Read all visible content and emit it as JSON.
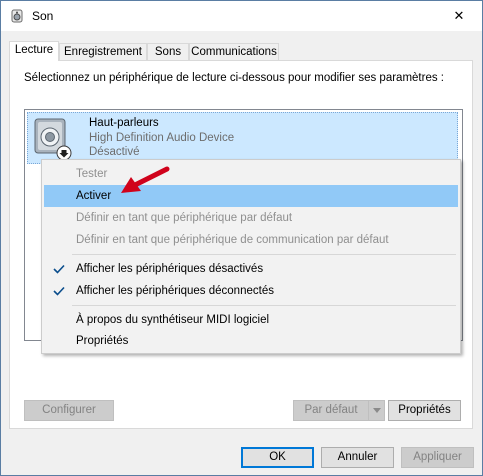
{
  "window": {
    "title": "Son",
    "close_symbol": "✕"
  },
  "tabs": [
    {
      "label": "Lecture",
      "active": true
    },
    {
      "label": "Enregistrement",
      "active": false
    },
    {
      "label": "Sons",
      "active": false
    },
    {
      "label": "Communications",
      "active": false
    }
  ],
  "panel": {
    "instruction": "Sélectionnez un périphérique de lecture ci-dessous pour modifier ses paramètres :"
  },
  "device": {
    "name": "Haut-parleurs",
    "description": "High Definition Audio Device",
    "status": "Désactivé"
  },
  "context_menu": {
    "items": [
      {
        "label": "Tester",
        "enabled": false,
        "checked": false
      },
      {
        "label": "Activer",
        "enabled": true,
        "checked": false,
        "highlighted": true
      },
      {
        "label": "Définir en tant que périphérique par défaut",
        "enabled": false,
        "checked": false
      },
      {
        "label": "Définir en tant que périphérique de communication par défaut",
        "enabled": false,
        "checked": false
      },
      {
        "label": "Afficher les périphériques désactivés",
        "enabled": true,
        "checked": true
      },
      {
        "label": "Afficher les périphériques déconnectés",
        "enabled": true,
        "checked": true
      },
      {
        "label": "À propos du synthétiseur MIDI logiciel",
        "enabled": true,
        "checked": false
      },
      {
        "label": "Propriétés",
        "enabled": true,
        "checked": false
      }
    ]
  },
  "panel_buttons": {
    "configure": "Configurer",
    "set_default": "Par défaut",
    "properties": "Propriétés"
  },
  "dialog_buttons": {
    "ok": "OK",
    "cancel": "Annuler",
    "apply": "Appliquer"
  },
  "colors": {
    "selection": "#cce8ff",
    "menu_highlight": "#91c9f7",
    "annotation_arrow": "#d0021b",
    "accent": "#0078d7"
  },
  "icons": {
    "title": "speaker-icon",
    "device": "speaker-device-icon",
    "device_overlay": "disabled-arrow-icon",
    "check": "checkmark-icon",
    "close": "close-icon",
    "annotation": "red-arrow-icon"
  }
}
